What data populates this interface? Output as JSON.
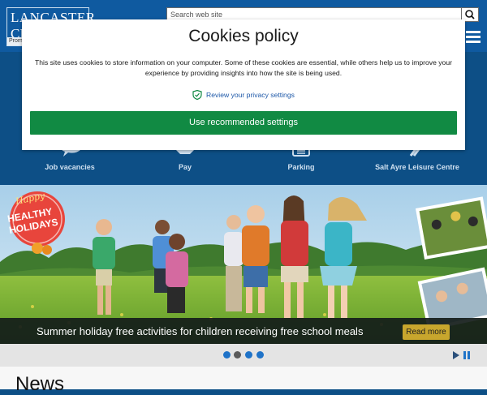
{
  "header": {
    "logo_line1": "LANCASTER",
    "logo_line2": "CI",
    "logo_tagline": "Promo",
    "search_placeholder": "Search web site",
    "icons": {
      "search": "search-icon",
      "menu": "hamburger-menu-icon"
    }
  },
  "quick_links": [
    {
      "label": "Job vacancies",
      "icon": "speech-bubble-icon"
    },
    {
      "label": "Pay",
      "icon": "credit-card-icon"
    },
    {
      "label": "Parking",
      "icon": "parking-ticket-icon"
    },
    {
      "label": "Salt Ayre Leisure Centre",
      "icon": "running-icon"
    }
  ],
  "hero": {
    "badge_line1": "Happy",
    "badge_line2": "HEALTHY",
    "badge_line3": "HOLIDAYS",
    "caption": "Summer holiday free activities for children receiving free school meals",
    "read_more": "Read more"
  },
  "carousel": {
    "slides": 4,
    "active_slide": 2,
    "icons": {
      "play": "play-icon",
      "pause": "pause-icon"
    }
  },
  "news": {
    "title": "News"
  },
  "cookie_modal": {
    "title": "Cookies policy",
    "body": "This site uses cookies to store information on your computer. Some of these cookies are essential, while others help us to improve your experience by providing insights into how the site is being used.",
    "privacy_link": "Review your privacy settings",
    "accept_button": "Use recommended settings",
    "icons": {
      "privacy": "shield-check-icon"
    }
  },
  "colors": {
    "header_blue": "#0f5aa0",
    "band_blue": "#0d4f86",
    "accept_green": "#118a43",
    "link_blue": "#1d58a8",
    "read_more_gold": "#c8a62d",
    "dot_active": "#5a5a5a",
    "dot_inactive": "#1f73c8"
  }
}
